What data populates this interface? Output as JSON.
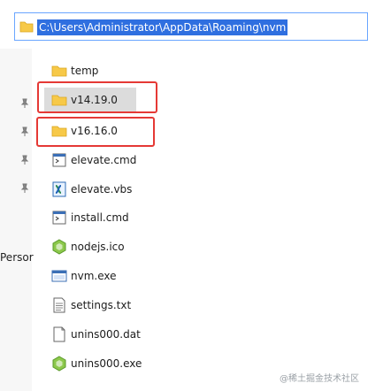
{
  "address_bar": {
    "path": "C:\\Users\\Administrator\\AppData\\Roaming\\nvm"
  },
  "sidebar": {
    "partial_label": "Persor"
  },
  "files": [
    {
      "name": "temp",
      "icon": "folder-icon"
    },
    {
      "name": "v14.19.0",
      "icon": "folder-icon",
      "selected": true
    },
    {
      "name": "v16.16.0",
      "icon": "folder-icon"
    },
    {
      "name": "elevate.cmd",
      "icon": "cmd-file-icon"
    },
    {
      "name": "elevate.vbs",
      "icon": "vbs-file-icon"
    },
    {
      "name": "install.cmd",
      "icon": "cmd-file-icon"
    },
    {
      "name": "nodejs.ico",
      "icon": "nodejs-icon"
    },
    {
      "name": "nvm.exe",
      "icon": "exe-icon"
    },
    {
      "name": "settings.txt",
      "icon": "text-file-icon"
    },
    {
      "name": "unins000.dat",
      "icon": "blank-file-icon"
    },
    {
      "name": "unins000.exe",
      "icon": "nodejs-icon"
    }
  ],
  "watermark": "@稀土掘金技术社区",
  "colors": {
    "highlight_box": "#e53935",
    "address_selection": "#2f6fe0",
    "folder": "#f7c948"
  }
}
